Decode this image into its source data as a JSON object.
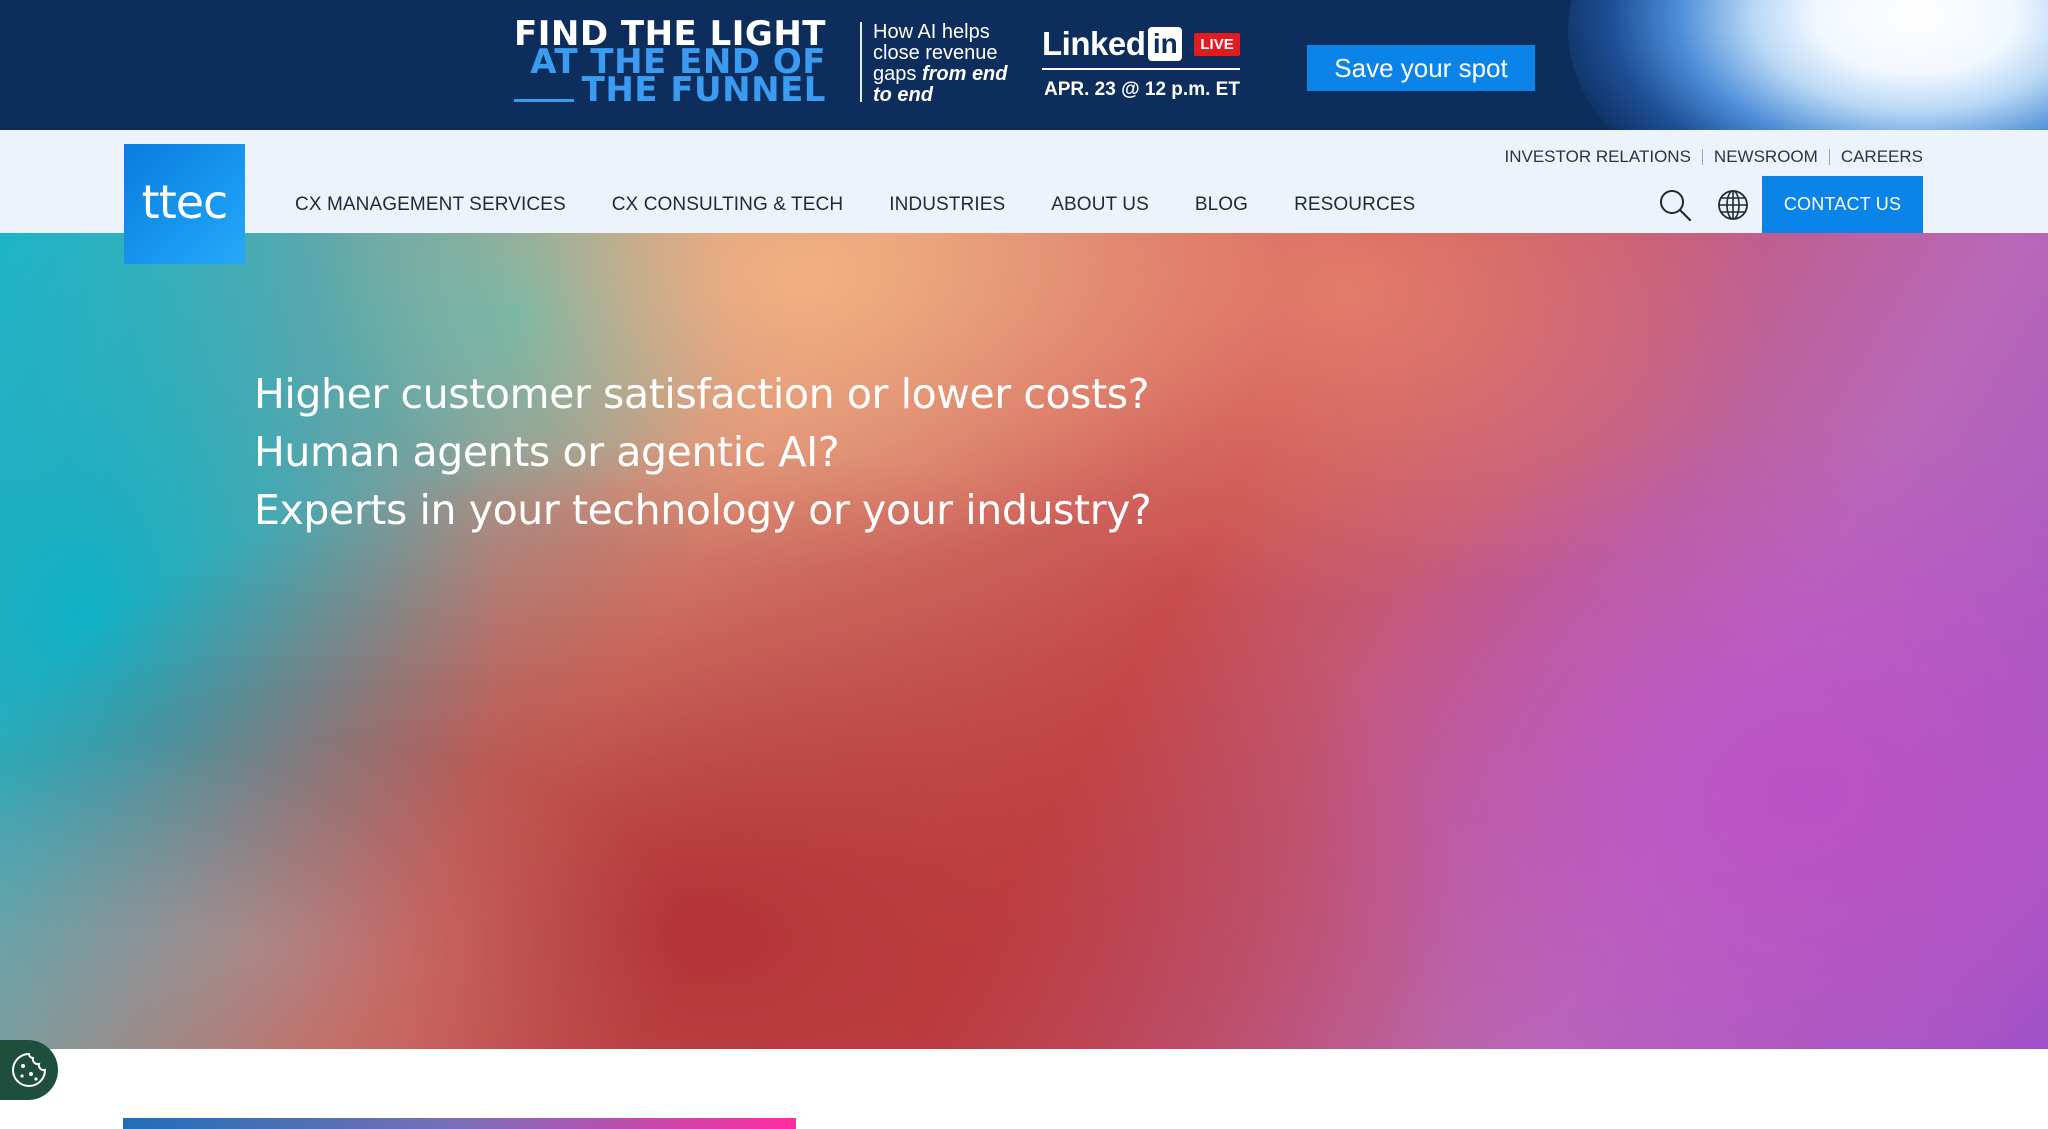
{
  "promo": {
    "headline": [
      "FIND THE LIGHT",
      "AT THE END OF",
      "THE FUNNEL"
    ],
    "subtext": "How AI helps close revenue gaps",
    "subtext_emphasis": "from end to end",
    "linkedin_word": "Linked",
    "linkedin_in": "in",
    "live_badge": "LIVE",
    "date": "APR. 23 @ 12 p.m. ET",
    "cta_label": "Save your spot"
  },
  "header": {
    "logo_text": "ttec",
    "utility_nav": [
      "INVESTOR RELATIONS",
      "NEWSROOM",
      "CAREERS"
    ],
    "main_nav": [
      "CX MANAGEMENT SERVICES",
      "CX CONSULTING & TECH",
      "INDUSTRIES",
      "ABOUT US",
      "BLOG",
      "RESOURCES"
    ],
    "icons": [
      "search-icon",
      "globe-icon"
    ],
    "contact_label": "CONTACT US"
  },
  "hero": {
    "lines": [
      "Higher customer satisfaction or lower costs?",
      "Human agents or agentic AI?",
      "Experts in your technology or your industry?"
    ]
  },
  "cookie": {
    "icon": "cookie-icon"
  },
  "colors": {
    "accent_blue": "#0a84e8",
    "banner_navy": "#0d2d5c",
    "live_red": "#e11b22",
    "header_bg": "#edf3fb"
  }
}
